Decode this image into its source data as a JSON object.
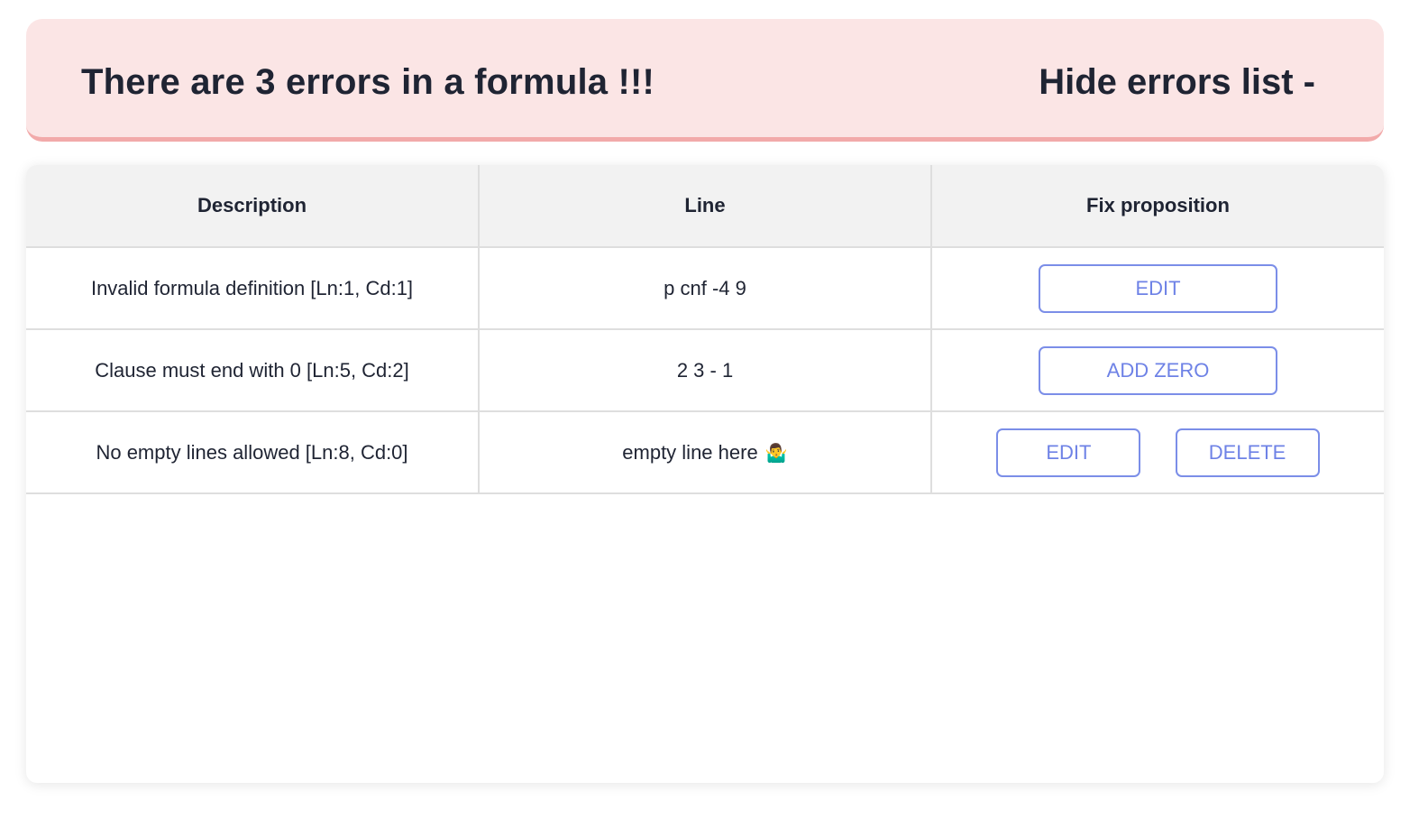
{
  "banner": {
    "title": "There are 3 errors in a formula !!!",
    "toggle_label": "Hide errors list -"
  },
  "table": {
    "headers": [
      "Description",
      "Line",
      "Fix proposition"
    ],
    "rows": [
      {
        "description": "Invalid formula definition [Ln:1, Cd:1]",
        "line": "p cnf -4 9",
        "actions": [
          "EDIT"
        ]
      },
      {
        "description": "Clause must end with 0 [Ln:5, Cd:2]",
        "line": "2 3 - 1",
        "actions": [
          "ADD ZERO"
        ]
      },
      {
        "description": "No empty lines allowed [Ln:8, Cd:0]",
        "line": "empty line here",
        "line_emoji": "🤷‍♂️",
        "actions": [
          "EDIT",
          "DELETE"
        ]
      }
    ]
  },
  "colors": {
    "banner_bg": "#fbe5e5",
    "banner_border": "#f2aaaa",
    "button_accent": "#6e82e6",
    "header_bg": "#f2f2f2",
    "text": "#1f2433"
  }
}
